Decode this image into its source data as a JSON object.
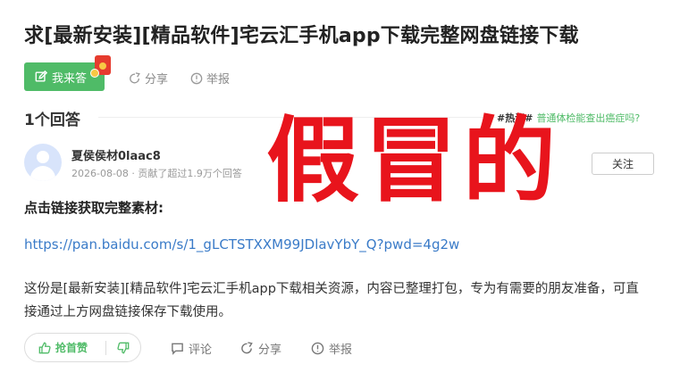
{
  "question": {
    "title": "求[最新安装][精品软件]宅云汇手机app下载完整网盘链接下载"
  },
  "actions": {
    "answer_label": "我来答",
    "share_label": "分享",
    "report_label": "举报"
  },
  "answers_header": {
    "count_label": "1个回答",
    "hot_tag": "#热议#",
    "hot_link": "普通体检能查出癌症吗?"
  },
  "answer": {
    "username": "夏侯侯材0laac8",
    "meta": "2026-08-08 · 贡献了超过1.9万个回答",
    "follow_label": "关注",
    "stamp_text": "假冒的",
    "bold_line": "点击链接获取完整素材:",
    "url": "https://pan.baidu.com/s/1_gLCTSTXXM99JDlavYbY_Q?pwd=4g2w",
    "description": "这份是[最新安装][精品软件]宅云汇手机app下载相关资源，内容已整理打包，专为有需要的朋友准备，可直接通过上方网盘链接保存下载使用。"
  },
  "bottom_actions": {
    "upvote_label": "抢首赞",
    "comment_label": "评论",
    "share_label": "分享",
    "report_label": "举报"
  },
  "colors": {
    "accent_green": "#4fbb67",
    "link_blue": "#3a7bc8",
    "stamp_red": "#e8141c"
  }
}
